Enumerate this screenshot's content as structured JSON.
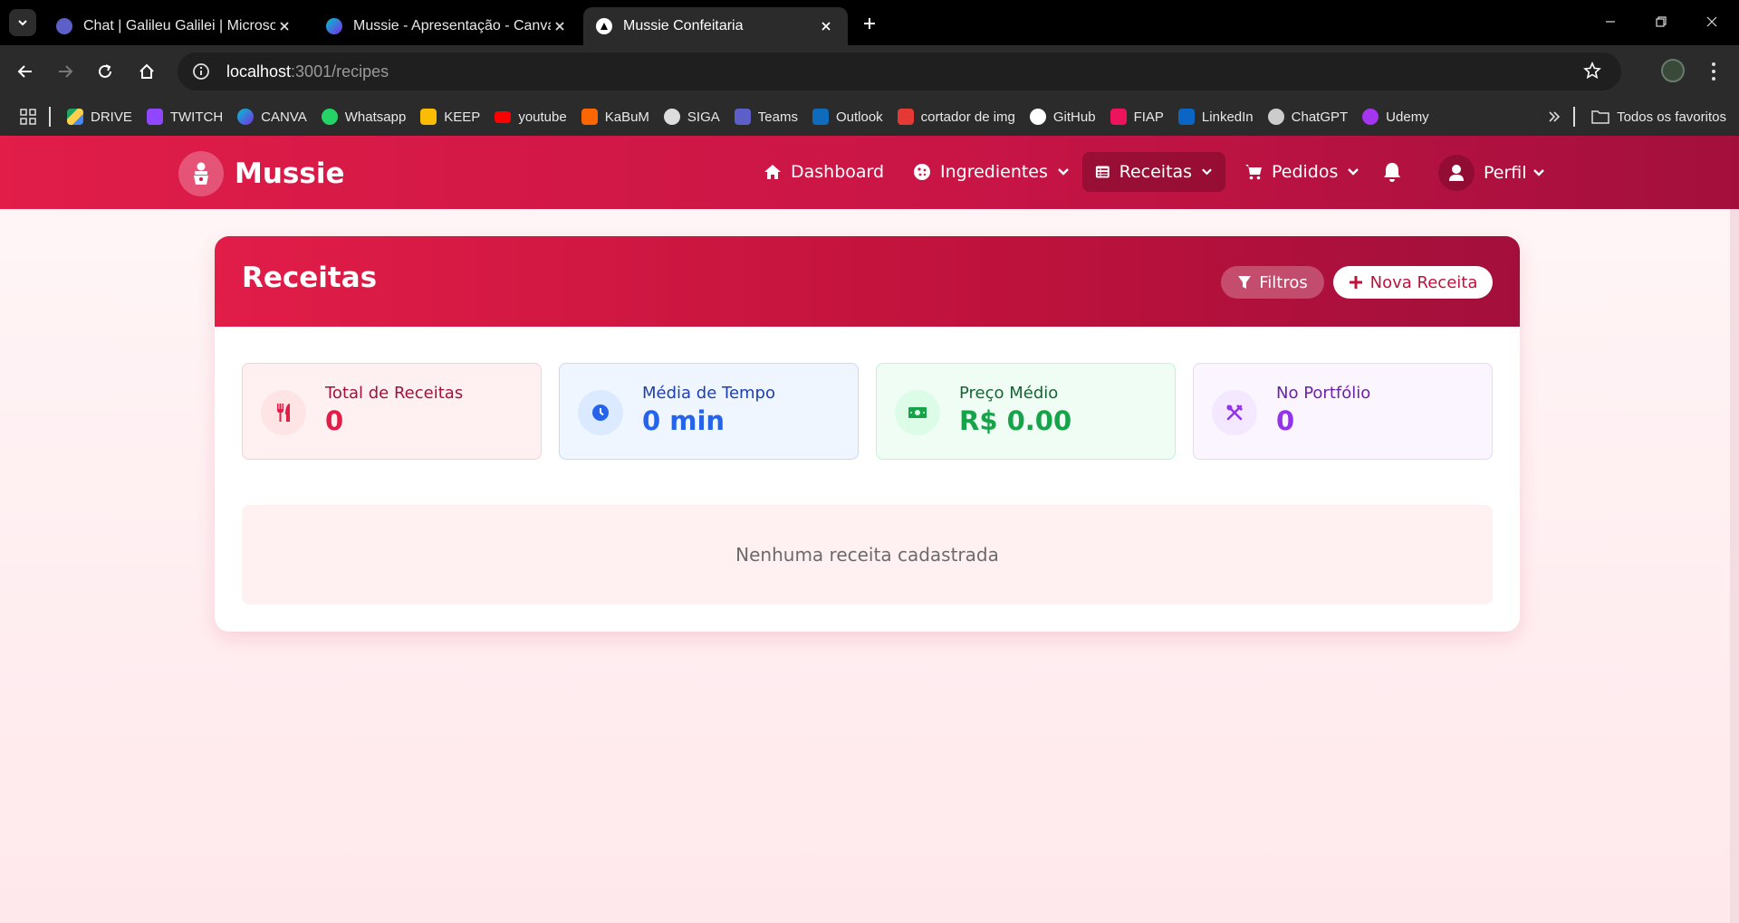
{
  "browser": {
    "tabs": [
      {
        "title": "Chat | Galileu Galilei | Microsoft",
        "icon": "teams-icon",
        "active": false
      },
      {
        "title": "Mussie - Apresentação - Canva",
        "icon": "canva-icon",
        "active": false
      },
      {
        "title": "Mussie Confeitaria",
        "icon": "vercel-icon",
        "active": true
      }
    ],
    "url_host": "localhost",
    "url_path": ":3001/recipes",
    "bookmarks": [
      {
        "label": "DRIVE",
        "icon": "drive-icon",
        "color": "#1fa463"
      },
      {
        "label": "TWITCH",
        "icon": "twitch-icon",
        "color": "#9146ff"
      },
      {
        "label": "CANVA",
        "icon": "canva-icon",
        "color": "#00c4cc"
      },
      {
        "label": "Whatsapp",
        "icon": "whatsapp-icon",
        "color": "#25d366"
      },
      {
        "label": "KEEP",
        "icon": "keep-icon",
        "color": "#fbbc04"
      },
      {
        "label": "youtube",
        "icon": "youtube-icon",
        "color": "#ff0000"
      },
      {
        "label": "KaBuM",
        "icon": "kabum-icon",
        "color": "#ff6500"
      },
      {
        "label": "SIGA",
        "icon": "globe-icon",
        "color": "#dddddd"
      },
      {
        "label": "Teams",
        "icon": "teams-icon",
        "color": "#5b5fc7"
      },
      {
        "label": "Outlook",
        "icon": "outlook-icon",
        "color": "#0f6cbd"
      },
      {
        "label": "cortador de img",
        "icon": "image-cutter-icon",
        "color": "#e53935"
      },
      {
        "label": "GitHub",
        "icon": "github-icon",
        "color": "#ffffff"
      },
      {
        "label": "FIAP",
        "icon": "fiap-icon",
        "color": "#ed145b"
      },
      {
        "label": "LinkedIn",
        "icon": "linkedin-icon",
        "color": "#0a66c2"
      },
      {
        "label": "ChatGPT",
        "icon": "chatgpt-icon",
        "color": "#cccccc"
      },
      {
        "label": "Udemy",
        "icon": "udemy-icon",
        "color": "#a435f0"
      }
    ],
    "all_bookmarks_label": "Todos os favoritos"
  },
  "app": {
    "brand": "Mussie",
    "nav": {
      "dashboard": "Dashboard",
      "ingredientes": "Ingredientes",
      "receitas": "Receitas",
      "pedidos": "Pedidos",
      "perfil": "Perfil"
    },
    "active_nav": "receitas"
  },
  "page": {
    "title": "Receitas",
    "filter_button": "Filtros",
    "new_button": "Nova Receita",
    "stats": [
      {
        "label": "Total de Receitas",
        "value": "0",
        "icon": "utensils-icon",
        "color": "#e11d48"
      },
      {
        "label": "Média de Tempo",
        "value": "0 min",
        "icon": "clock-icon",
        "color": "#2563eb"
      },
      {
        "label": "Preço Médio",
        "value": "R$ 0.00",
        "icon": "money-icon",
        "color": "#16a34a"
      },
      {
        "label": "No Portfólio",
        "value": "0",
        "icon": "spoon-fork-cross-icon",
        "color": "#9333ea"
      }
    ],
    "empty_message": "Nenhuma receita cadastrada"
  }
}
